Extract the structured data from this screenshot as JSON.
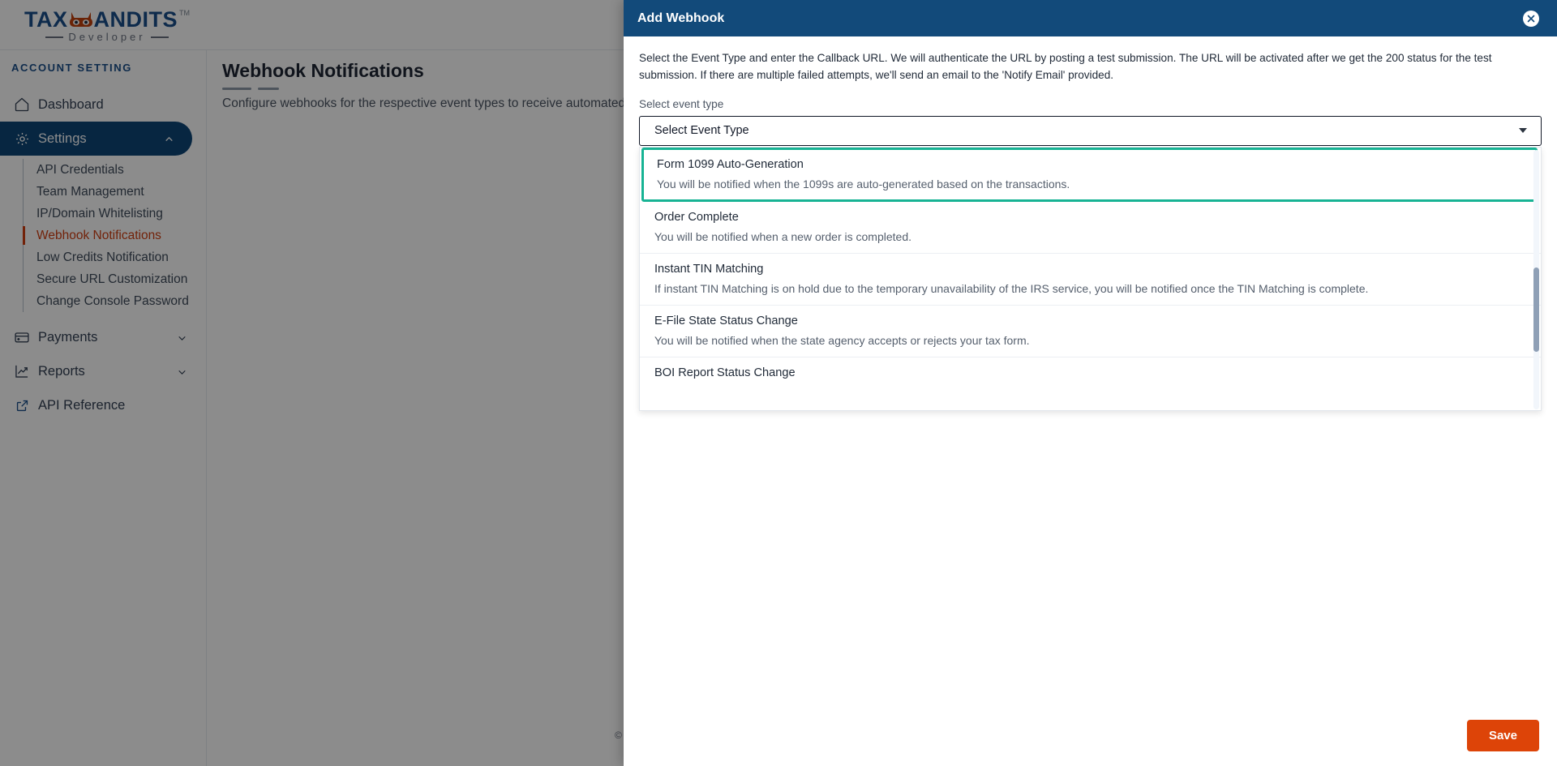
{
  "brand": {
    "name_part1": "TAX",
    "name_part2": "ANDITS",
    "tm": "TM",
    "tagline": "Developer"
  },
  "sidebar": {
    "section_label": "ACCOUNT SETTING",
    "items": [
      {
        "label": "Dashboard",
        "icon": "home-icon",
        "expandable": false
      },
      {
        "label": "Settings",
        "icon": "gear-icon",
        "expandable": true,
        "active": true
      }
    ],
    "settings_children": [
      {
        "label": "API Credentials"
      },
      {
        "label": "Team Management"
      },
      {
        "label": "IP/Domain Whitelisting"
      },
      {
        "label": "Webhook Notifications",
        "selected": true
      },
      {
        "label": "Low Credits Notification"
      },
      {
        "label": "Secure URL Customization"
      },
      {
        "label": "Change Console Password"
      }
    ],
    "bottom_items": [
      {
        "label": "Payments",
        "icon": "credit-card-icon",
        "expandable": true
      },
      {
        "label": "Reports",
        "icon": "chart-line-icon",
        "expandable": true
      },
      {
        "label": "API Reference",
        "icon": "external-link-icon",
        "expandable": false
      }
    ]
  },
  "main": {
    "title": "Webhook Notifications",
    "subtitle": "Configure webhooks for the respective event types to receive automated notifica",
    "footer_copyright": "©"
  },
  "modal": {
    "title": "Add Webhook",
    "close_icon": "close-icon",
    "description": "Select the Event Type and enter the Callback URL. We will authenticate the URL by posting a test submission. The URL will be activated after we get the 200 status for the test submission. If there are multiple failed attempts, we'll send an email to the 'Notify Email' provided.",
    "field_label": "Select event type",
    "select_value": "Select Event Type",
    "select_placeholder": "Select Event Type",
    "save_label": "Save",
    "options": [
      {
        "title": "Form 1099 Auto-Generation",
        "desc": "You will be notified when the 1099s are auto-generated based on the transactions.",
        "highlighted": true
      },
      {
        "title": "Order Complete",
        "desc": "You will be notified when a new order is completed.",
        "highlighted": false
      },
      {
        "title": "Instant TIN Matching",
        "desc": "If instant TIN Matching is on hold due to the temporary unavailability of the IRS service, you will be notified once the TIN Matching is complete.",
        "highlighted": false
      },
      {
        "title": "E-File State Status Change",
        "desc": "You will be notified when the state agency accepts or rejects your tax form.",
        "highlighted": false
      },
      {
        "title": "BOI Report Status Change",
        "desc": "",
        "highlighted": false
      }
    ]
  },
  "colors": {
    "brand_blue": "#1b4f8a",
    "modal_header": "#124a7a",
    "sidebar_active": "#0d4677",
    "selected_orange": "#cf3f12",
    "save_orange": "#dd4408",
    "highlight_green": "#17b394"
  }
}
